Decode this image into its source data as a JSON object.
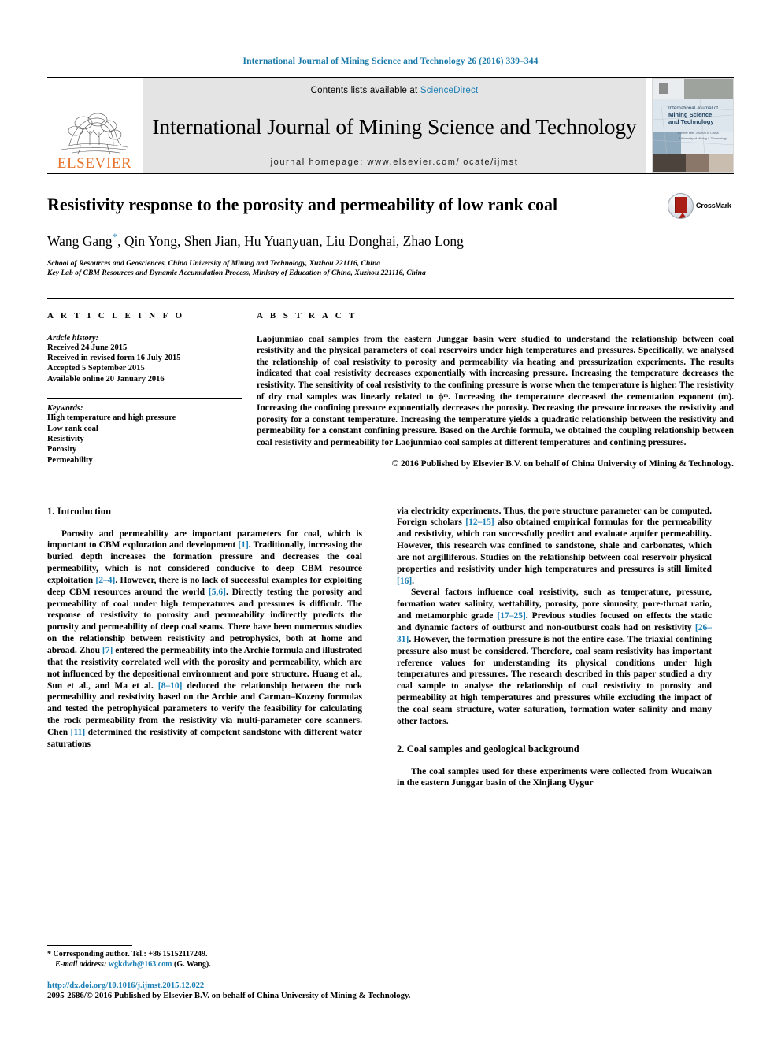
{
  "running_head": "International Journal of Mining Science and Technology 26 (2016) 339–344",
  "masthead": {
    "publisher_name": "ELSEVIER",
    "contents_prefix": "Contents lists available at ",
    "sciencedirect": "ScienceDirect",
    "journal_title": "International Journal of Mining Science and Technology",
    "homepage": "journal homepage: www.elsevier.com/locate/ijmst",
    "cover_title_line1": "International Journal of",
    "cover_title_line2": "Mining Science",
    "cover_title_line3": "and Technology",
    "cover_sub1": "Former title: Journal of China",
    "cover_sub2": "University of Mining & Technology"
  },
  "accent_blue": "#1b7fb5",
  "elsevier_orange": "#e8742c",
  "article": {
    "title": "Resistivity response to the porosity and permeability of low rank coal",
    "authors": "Wang Gang*, Qin Yong, Shen Jian, Hu Yuanyuan, Liu Donghai, Zhao Long",
    "authors_pre": "Wang Gang",
    "authors_post": ", Qin Yong, Shen Jian, Hu Yuanyuan, Liu Donghai, Zhao Long",
    "affiliation_1": "School of Resources and Geosciences, China University of Mining and Technology, Xuzhou 221116, China",
    "affiliation_2": "Key Lab of CBM Resources and Dynamic Accumulation Process, Ministry of Education of China, Xuzhou 221116, China",
    "crossmark_label": "CrossMark"
  },
  "article_info": {
    "heading": "A R T I C L E    I N F O",
    "history_label": "Article history:",
    "history": [
      "Received 24 June 2015",
      "Received in revised form 16 July 2015",
      "Accepted 5 September 2015",
      "Available online 20 January 2016"
    ],
    "keywords_label": "Keywords:",
    "keywords": [
      "High temperature and high pressure",
      "Low rank coal",
      "Resistivity",
      "Porosity",
      "Permeability"
    ]
  },
  "abstract": {
    "heading": "A B S T R A C T",
    "text": "Laojunmiao coal samples from the eastern Junggar basin were studied to understand the relationship between coal resistivity and the physical parameters of coal reservoirs under high temperatures and pressures. Specifically, we analysed the relationship of coal resistivity to porosity and permeability via heating and pressurization experiments. The results indicated that coal resistivity decreases exponentially with increasing pressure. Increasing the temperature decreases the resistivity. The sensitivity of coal resistivity to the confining pressure is worse when the temperature is higher. The resistivity of dry coal samples was linearly related to ϕᵐ. Increasing the temperature decreased the cementation exponent (m). Increasing the confining pressure exponentially decreases the porosity. Decreasing the pressure increases the resistivity and porosity for a constant temperature. Increasing the temperature yields a quadratic relationship between the resistivity and permeability for a constant confining pressure. Based on the Archie formula, we obtained the coupling relationship between coal resistivity and permeability for Laojunmiao coal samples at different temperatures and confining pressures.",
    "copyright": "© 2016 Published by Elsevier B.V. on behalf of China University of Mining & Technology."
  },
  "body": {
    "section_1_title": "1. Introduction",
    "section_2_title": "2. Coal samples and geological background",
    "left_para_1_a": "Porosity and permeability are important parameters for coal, which is important to CBM exploration and development ",
    "left_ref_1": "[1]",
    "left_para_1_b": ". Traditionally, increasing the buried depth increases the formation pressure and decreases the coal permeability, which is not considered conducive to deep CBM resource exploitation ",
    "left_ref_2": "[2–4]",
    "left_para_1_c": ". However, there is no lack of successful examples for exploiting deep CBM resources around the world ",
    "left_ref_3": "[5,6]",
    "left_para_1_d": ". Directly testing the porosity and permeability of coal under high temperatures and pressures is difficult. The response of resistivity to porosity and permeability indirectly predicts the porosity and permeability of deep coal seams. There have been numerous studies on the relationship between resistivity and petrophysics, both at home and abroad. Zhou ",
    "left_ref_4": "[7]",
    "left_para_1_e": " entered the permeability into the Archie formula and illustrated that the resistivity correlated well with the porosity and permeability, which are not influenced by the depositional environment and pore structure. Huang et al., Sun et al., and Ma et al. ",
    "left_ref_5": "[8–10]",
    "left_para_1_f": " deduced the relationship between the rock permeability and resistivity based on the Archie and Carman–Kozeny formulas and tested the petrophysical parameters to verify the feasibility for calculating the rock permeability from the resistivity via multi-parameter core scanners. Chen ",
    "left_ref_6": "[11]",
    "left_para_1_g": " determined the resistivity of competent sandstone with different water saturations",
    "right_para_1_a": "via electricity experiments. Thus, the pore structure parameter can be computed. Foreign scholars ",
    "right_ref_1": "[12–15]",
    "right_para_1_b": " also obtained empirical formulas for the permeability and resistivity, which can successfully predict and evaluate aquifer permeability. However, this research was confined to sandstone, shale and carbonates, which are not argilliferous. Studies on the relationship between coal reservoir physical properties and resistivity under high temperatures and pressures is still limited ",
    "right_ref_2": "[16]",
    "right_para_1_c": ".",
    "right_para_2_a": "Several factors influence coal resistivity, such as temperature, pressure, formation water salinity, wettability, porosity, pore sinuosity, pore-throat ratio, and metamorphic grade ",
    "right_ref_3": "[17–25]",
    "right_para_2_b": ". Previous studies focused on effects the static and dynamic factors of outburst and non-outburst coals had on resistivity ",
    "right_ref_4": "[26–31]",
    "right_para_2_c": ". However, the formation pressure is not the entire case. The triaxial confining pressure also must be considered. Therefore, coal seam resistivity has important reference values for understanding its physical conditions under high temperatures and pressures. The research described in this paper studied a dry coal sample to analyse the relationship of coal resistivity to porosity and permeability at high temperatures and pressures while excluding the impact of the coal seam structure, water saturation, formation water salinity and many other factors.",
    "right_para_3": "The coal samples used for these experiments were collected from Wucaiwan in the eastern Junggar basin of the Xinjiang Uygur"
  },
  "footnote": {
    "star": "*",
    "corresponding": " Corresponding author. Tel.: +86 15152117249.",
    "email_label": "E-mail address:",
    "email": "wgkdwb@163.com",
    "email_suffix": " (G. Wang)."
  },
  "footer": {
    "doi": "http://dx.doi.org/10.1016/j.ijmst.2015.12.022",
    "issn": "2095-2686/© 2016 Published by Elsevier B.V. on behalf of China University of Mining & Technology."
  }
}
